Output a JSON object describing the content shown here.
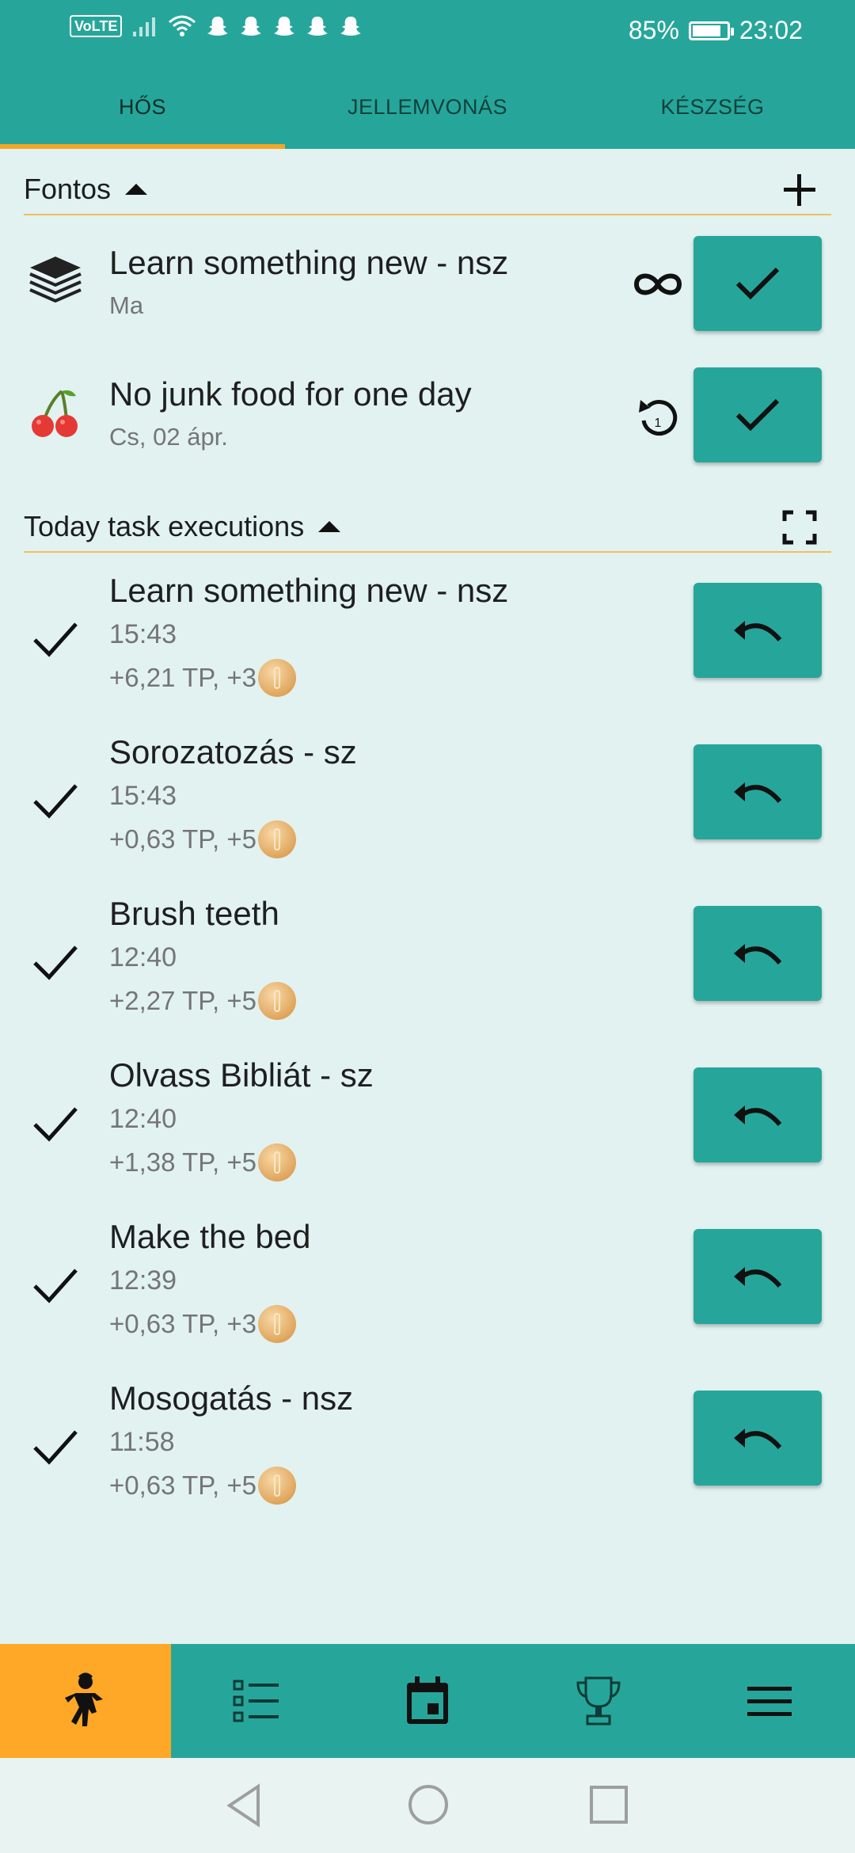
{
  "status": {
    "network": "VoLTE",
    "battery": "85%",
    "battery_level": 0.85,
    "time": "23:02"
  },
  "tabs": [
    {
      "label": "HŐS",
      "active": true
    },
    {
      "label": "JELLEMVONÁS",
      "active": false
    },
    {
      "label": "KÉSZSÉG",
      "active": false
    }
  ],
  "important": {
    "title": "Fontos",
    "items": [
      {
        "title": "Learn something new - nsz",
        "subtitle": "Ma",
        "icon": "books-icon",
        "side_icon": "infinity-icon"
      },
      {
        "title": "No junk food for one day",
        "subtitle": "Cs, 02 ápr.",
        "icon": "cherries-icon",
        "side_icon": "repeat-once-icon"
      }
    ]
  },
  "today": {
    "title": "Today task executions",
    "items": [
      {
        "title": "Learn something new - nsz",
        "time": "15:43",
        "reward": "+6,21 TP, +3"
      },
      {
        "title": "Sorozatozás - sz",
        "time": "15:43",
        "reward": "+0,63 TP, +5"
      },
      {
        "title": "Brush teeth",
        "time": "12:40",
        "reward": "+2,27 TP, +5"
      },
      {
        "title": "Olvass Bibliát - sz",
        "time": "12:40",
        "reward": "+1,38 TP, +5"
      },
      {
        "title": "Make the bed",
        "time": "12:39",
        "reward": "+0,63 TP, +3"
      },
      {
        "title": "Mosogatás - nsz",
        "time": "11:58",
        "reward": "+0,63 TP, +5"
      }
    ]
  },
  "bottom_nav": [
    {
      "icon": "hero-icon",
      "active": true
    },
    {
      "icon": "task-list-icon",
      "active": false
    },
    {
      "icon": "calendar-icon",
      "active": false
    },
    {
      "icon": "trophy-icon",
      "active": false
    },
    {
      "icon": "menu-icon",
      "active": false
    }
  ],
  "colors": {
    "primary": "#26a69a",
    "accent": "#ffa726",
    "background": "#e1f2f1"
  }
}
